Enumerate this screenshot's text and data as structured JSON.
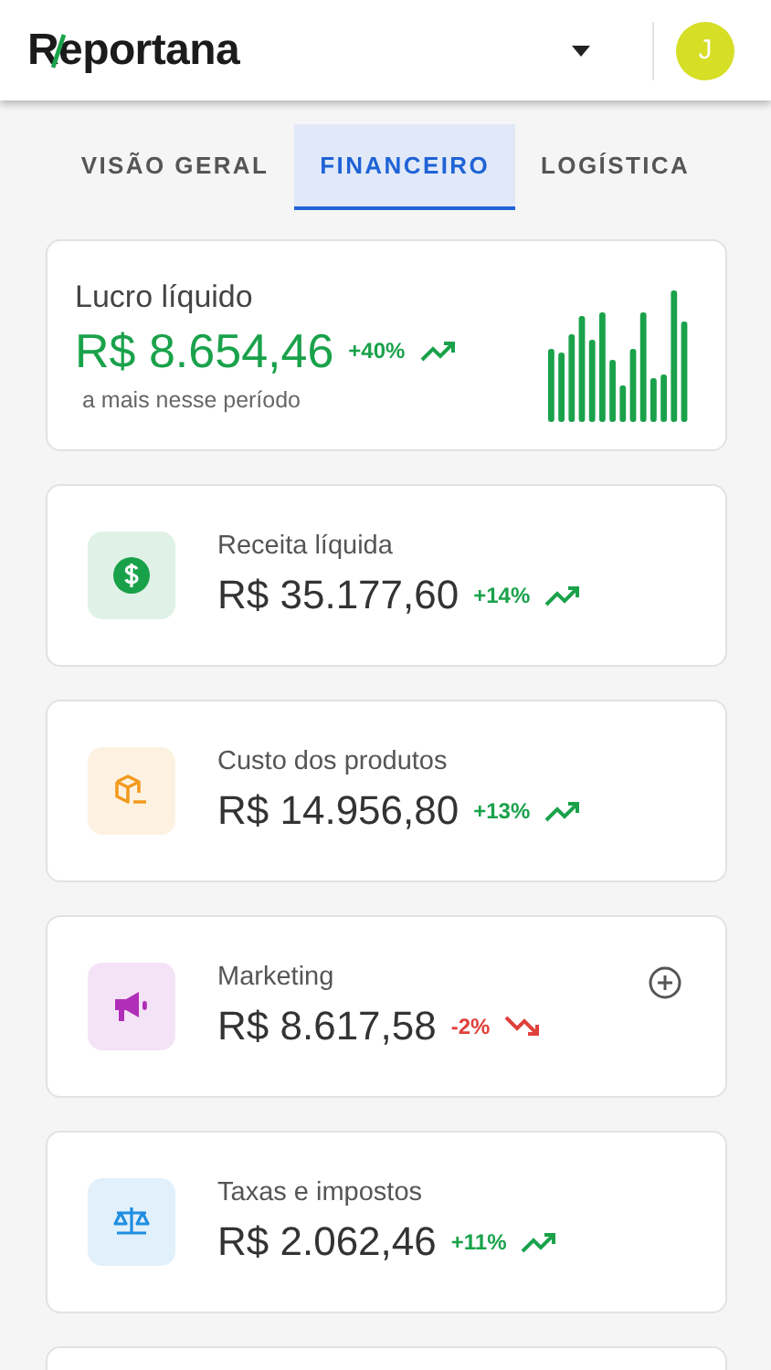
{
  "header": {
    "logo": "Reportana",
    "avatar_initial": "J"
  },
  "tabs": [
    {
      "label": "VISÃO GERAL",
      "selected": false
    },
    {
      "label": "FINANCEIRO",
      "selected": true
    },
    {
      "label": "LOGÍSTICA",
      "selected": false
    }
  ],
  "summary": {
    "title": "Lucro líquido",
    "value": "R$ 8.654,46",
    "change": "+40%",
    "rising": true,
    "caption": "a mais nesse período"
  },
  "metrics": [
    {
      "kind": "dollar",
      "color": "#19a14a",
      "title": "Receita líquida",
      "value": "R$ 35.177,60",
      "change": "+14%",
      "rising": true,
      "add_button": false
    },
    {
      "kind": "box",
      "color": "#f29a1f",
      "title": "Custo dos produtos",
      "value": "R$ 14.956,80",
      "change": "+13%",
      "rising": true,
      "add_button": false
    },
    {
      "kind": "megaphone",
      "color": "#b02eb8",
      "title": "Marketing",
      "value": "R$ 8.617,58",
      "change": "-2%",
      "rising": false,
      "add_button": true
    },
    {
      "kind": "scale",
      "color": "#1f8ee0",
      "title": "Taxas e impostos",
      "value": "R$ 2.062,46",
      "change": "+11%",
      "rising": true,
      "add_button": false
    }
  ]
}
